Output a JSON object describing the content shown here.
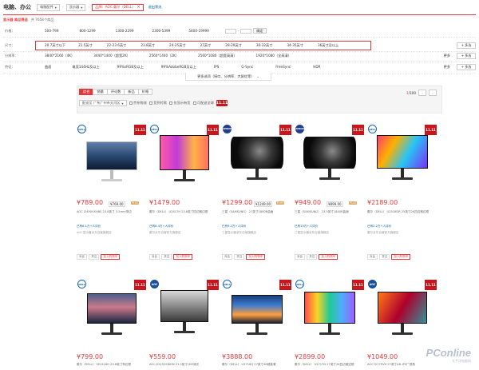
{
  "breadcrumb": {
    "root": "电脑、办公",
    "items": [
      {
        "label": "电脑配件",
        "selected": false
      },
      {
        "label": "显示器",
        "selected": false
      },
      {
        "label": "品牌：AOC 戴尔（DELL）",
        "selected": true
      }
    ],
    "clear": "退出筛选"
  },
  "summary": {
    "title": "显示器 商品筛选",
    "count": "共 7658个商品"
  },
  "filters": [
    {
      "label": "价格：",
      "options": [
        "500-799",
        "800-1299",
        "1300-2299",
        "2300-5399",
        "5400-19999"
      ],
      "custom_ok": "确定"
    },
    {
      "label": "尺寸：",
      "options": [
        "20.7英寸以下",
        "21.5英寸",
        "22-23.6英寸",
        "23.8英寸",
        "24-25英寸",
        "27英寸",
        "28-29英寸",
        "30-32英寸",
        "34-35英寸",
        "36英寸及以上"
      ],
      "more": "+ 多选"
    },
    {
      "label": "分辨率：",
      "options": [
        "3840*2160（4K）",
        "3440*1440（超宽2K）",
        "2560*1440（2K）",
        "2560*1080（超宽高清）",
        "1920*1080（全高清）"
      ],
      "more_label": "更多",
      "more": "+ 多选"
    },
    {
      "label": "特征：",
      "options": [
        "曲面",
        "电竞144Hz及以上",
        "99%sRGB及以上",
        "99%AdobeRGB及以上",
        "IPS",
        "G-Sync",
        "FreeSync",
        "HDR"
      ],
      "more_label": "更多",
      "more": "+ 多选"
    }
  ],
  "more_options": "更多选项（接口、分辨率、大屏优等）",
  "sort": {
    "tabs": [
      "综合",
      "销量",
      "评论数",
      "新品",
      "价格"
    ],
    "active": "综合",
    "page_num": "1",
    "page_total": "/100",
    "location": "配送至  广东广州市天河区",
    "checks": [
      "京东物流",
      "货到付款",
      "仅显示有货",
      "可配送全球"
    ],
    "badge": "11.11"
  },
  "products": [
    {
      "brand": "dell",
      "brand_label": "DELL",
      "price": "¥789.00",
      "price_alt": "¥769.00",
      "plus": "PLUS",
      "title": "AOC I2490VXHBS 23.8英寸 3.5mm窄边",
      "comments": "已有6.1万+人评价",
      "shop": "AOC显示器京东自营旗舰店"
    },
    {
      "brand": "dell",
      "brand_label": "DELL",
      "price": "¥1479.00",
      "title": "戴尔（DELL） U2417H 23.8英寸四边微边框",
      "comments": "已有8.4万+人评价",
      "shop": "戴尔京东自营官方旗舰店"
    },
    {
      "brand": "sam",
      "brand_label": "SAMSUNG",
      "price": "¥1299.00",
      "price_alt": "¥1249.00",
      "plus": "PLUS",
      "title": "三星（SAMSUNG） 27英寸1800R曲面",
      "comments": "已有9.2万+人评价",
      "shop": "三星显示器京东自营旗舰店"
    },
    {
      "brand": "sam",
      "brand_label": "SAMSUNG",
      "price": "¥949.00",
      "price_alt": "¥899.00",
      "plus": "PLUS",
      "title": "三星（SAMSUNG） 23.5英寸1800R曲面",
      "comments": "已有19万+人评价",
      "shop": "三星显示器京东自营旗舰店"
    },
    {
      "brand": "dell",
      "brand_label": "DELL",
      "price": "¥2189.00",
      "title": "戴尔（DELL） U2518DR 25英寸2K四边微边框",
      "comments": "已有2.2万+人评价",
      "shop": "戴尔京东自营官方旗舰店"
    },
    {
      "brand": "dell",
      "brand_label": "DELL",
      "price": "¥799.00",
      "title": "戴尔（DELL） SE2418H 23.8英寸窄边框",
      "comments": "已有5.6万+人评价",
      "shop": "戴尔京东自营官方旗舰店"
    },
    {
      "brand": "aoc",
      "brand_label": "AOC",
      "price": "¥559.00",
      "title": "AOC E2252SWDN 21.5英寸LED背光",
      "comments": "已有12万+人评价",
      "shop": "AOC显示器京东自营旗舰店"
    },
    {
      "brand": "dell",
      "brand_label": "DELL",
      "price": "¥3888.00",
      "title": "戴尔（DELL） U2718Q 27英寸4K超高清",
      "comments": "已有1.1万+人评价",
      "shop": "戴尔京东自营官方旗舰店"
    },
    {
      "brand": "dell",
      "brand_label": "DELL",
      "price": "¥2899.00",
      "title": "戴尔（DELL） U2717D 27英寸2K四边微边框",
      "comments": "已有1.8万+人评价",
      "shop": "戴尔京东自营官方旗舰店"
    },
    {
      "brand": "aoc",
      "brand_label": "AOC",
      "price": "¥1049.00",
      "title": "AOC I2779VH 27英寸AH-IPS广视角",
      "comments": "已有3.4万+人评价",
      "shop": "AOC显示器京东自营旗舰店"
    }
  ],
  "card_ops": [
    "对比",
    "关注",
    "加入购物车"
  ],
  "tag11_text": "11.11",
  "watermark": {
    "brand": "PConline",
    "sub": "太平洋电脑网"
  }
}
